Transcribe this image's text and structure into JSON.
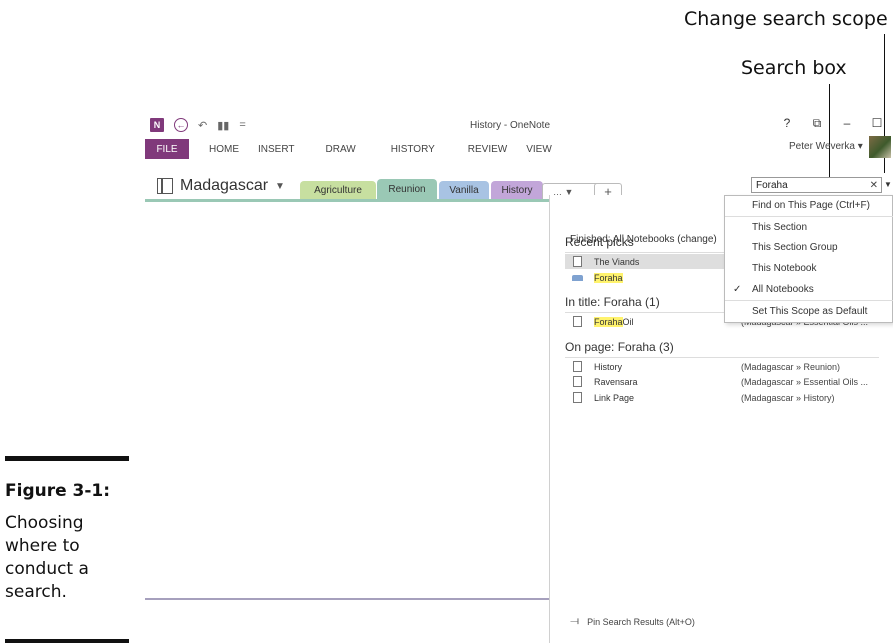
{
  "callouts": {
    "scope": "Change search scope",
    "search_box": "Search box"
  },
  "caption": {
    "title": "Figure 3-1:",
    "body": "Choosing where to conduct a search."
  },
  "window": {
    "title": "History - OneNote",
    "help": "?",
    "restore": "⧉",
    "minimize": "–",
    "maximize": "☐",
    "close": "✕"
  },
  "qat": {
    "logo": "N",
    "back": "←",
    "undo": "↶",
    "view": "▮▮",
    "more": "="
  },
  "ribbon": {
    "file": "FILE",
    "tabs": [
      "HOME",
      "INSERT",
      "DRAW",
      "HISTORY",
      "REVIEW",
      "VIEW"
    ]
  },
  "user": "Peter Weverka ▾",
  "notebook": {
    "name": "Madagascar",
    "caret": "▼"
  },
  "sections": [
    {
      "label": "Agriculture",
      "color": "#c7dfa0"
    },
    {
      "label": "Reunion",
      "color": "#9ac8b5"
    },
    {
      "label": "Vanilla",
      "color": "#a8c3e3"
    },
    {
      "label": "History",
      "color": "#c2a6d9"
    }
  ],
  "sections_more": "… ▼",
  "sections_add": "+",
  "search": {
    "value": "Foraha",
    "clear": "✕",
    "scope_arrow": "▼"
  },
  "results": {
    "finished": "Finished: All Notebooks (change)",
    "recent_heading": "Recent picks",
    "recent": [
      {
        "title": "The Viands"
      },
      {
        "title": "Foraha"
      }
    ],
    "title_heading": "In title: Foraha (1)",
    "title_results": [
      {
        "match": "Foraha",
        "rest": " Oil",
        "path": "(Madagascar » Essential Oils ..."
      }
    ],
    "page_heading": "On page: Foraha (3)",
    "page_results": [
      {
        "title": "History",
        "path": "(Madagascar » Reunion)"
      },
      {
        "title": "Ravensara",
        "path": "(Madagascar » Essential Oils ..."
      },
      {
        "title": "Link Page",
        "path": "(Madagascar » History)"
      }
    ],
    "pin": "Pin Search Results (Alt+O)",
    "pin_icon": "pushpin-icon"
  },
  "scope_menu": {
    "items": [
      "Find on This Page (Ctrl+F)",
      "This Section",
      "This Section Group",
      "This Notebook",
      "All Notebooks",
      "Set This Scope as Default"
    ],
    "checked_index": 4,
    "check": "✓"
  },
  "colors": {
    "accent": "#80397b",
    "highlight": "#fff36d"
  }
}
